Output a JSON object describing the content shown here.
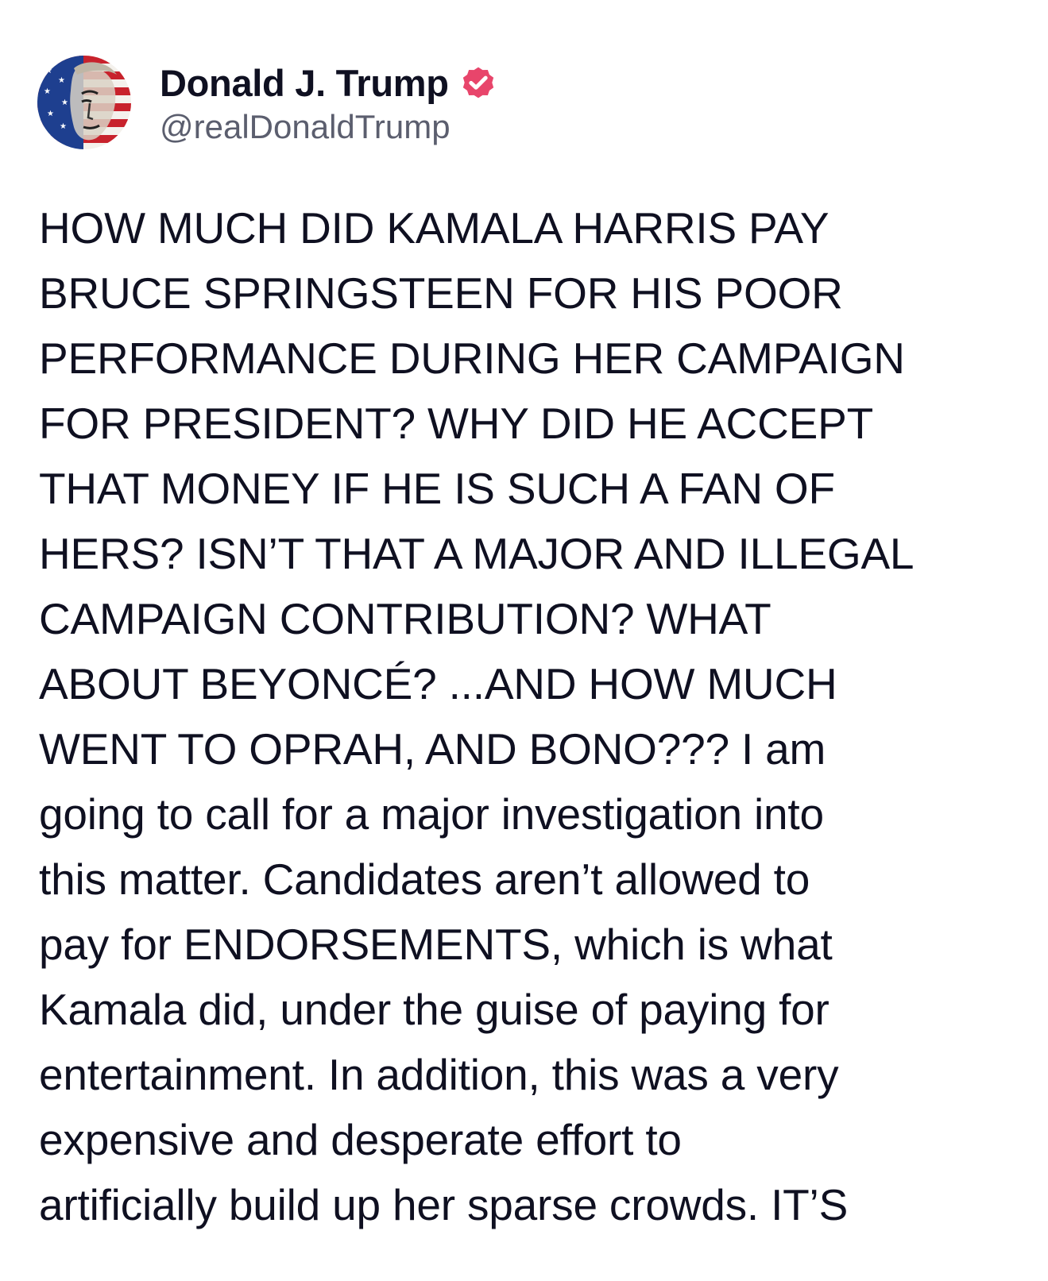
{
  "author": {
    "display_name": "Donald J. Trump",
    "handle": "@realDonaldTrump",
    "avatar_icon": "avatar-flag-portrait-icon",
    "verified_icon": "verified-badge-icon",
    "verified_color": "#e8456b"
  },
  "post": {
    "text": "HOW MUCH DID KAMALA HARRIS PAY\nBRUCE SPRINGSTEEN FOR HIS POOR\nPERFORMANCE DURING HER CAMPAIGN\nFOR PRESIDENT? WHY DID HE ACCEPT\nTHAT MONEY IF HE IS SUCH A FAN OF\nHERS? ISN’T THAT A MAJOR AND ILLEGAL\nCAMPAIGN CONTRIBUTION? WHAT\nABOUT BEYONCÉ? ...AND HOW MUCH\nWENT TO OPRAH, AND BONO??? I am\ngoing to call for a major investigation into\nthis matter. Candidates aren’t allowed to\npay for ENDORSEMENTS, which is what\nKamala did, under the guise of paying for\nentertainment. In addition, this was a very\nexpensive and desperate effort to\nartificially build up her sparse crowds. IT’S"
  }
}
